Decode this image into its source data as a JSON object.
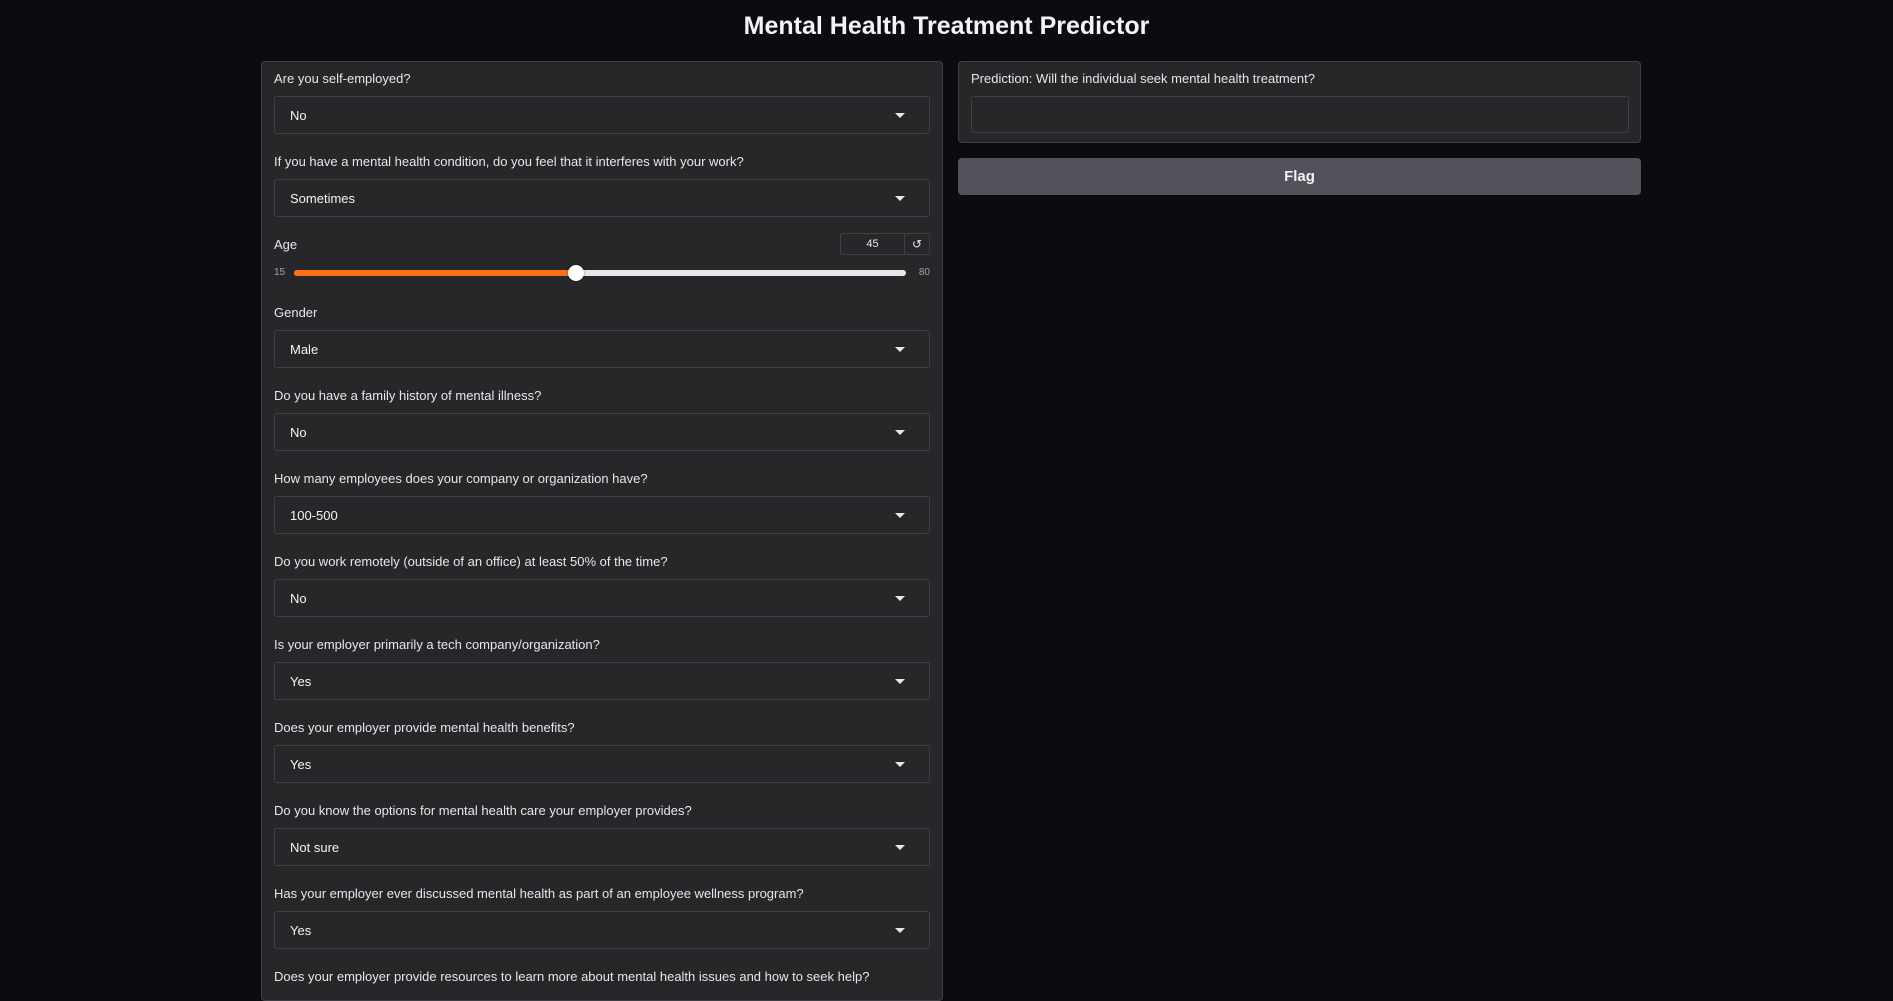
{
  "title": "Mental Health Treatment Predictor",
  "form": {
    "self_employed": {
      "label": "Are you self-employed?",
      "value": "No"
    },
    "work_interfere": {
      "label": "If you have a mental health condition, do you feel that it interferes with your work?",
      "value": "Sometimes"
    },
    "age": {
      "label": "Age",
      "value": 45,
      "min": 15,
      "max": 80,
      "display_value": "45",
      "min_label": "15",
      "max_label": "80"
    },
    "gender": {
      "label": "Gender",
      "value": "Male"
    },
    "family_history": {
      "label": "Do you have a family history of mental illness?",
      "value": "No"
    },
    "no_employees": {
      "label": "How many employees does your company or organization have?",
      "value": "100-500"
    },
    "remote_work": {
      "label": "Do you work remotely (outside of an office) at least 50% of the time?",
      "value": "No"
    },
    "tech_company": {
      "label": "Is your employer primarily a tech company/organization?",
      "value": "Yes"
    },
    "benefits": {
      "label": "Does your employer provide mental health benefits?",
      "value": "Yes"
    },
    "care_options": {
      "label": "Do you know the options for mental health care your employer provides?",
      "value": "Not sure"
    },
    "wellness_program": {
      "label": "Has your employer ever discussed mental health as part of an employee wellness program?",
      "value": "Yes"
    },
    "seek_help": {
      "label": "Does your employer provide resources to learn more about mental health issues and how to seek help?"
    }
  },
  "output": {
    "label": "Prediction: Will the individual seek mental health treatment?",
    "value": ""
  },
  "flag_label": "Flag",
  "colors": {
    "accent": "#f97316",
    "panel": "#27272a",
    "background": "#0b0c0f",
    "button": "#52525b"
  },
  "icons": {
    "dropdown": "chevron-down-icon",
    "reset": "reset-icon"
  }
}
